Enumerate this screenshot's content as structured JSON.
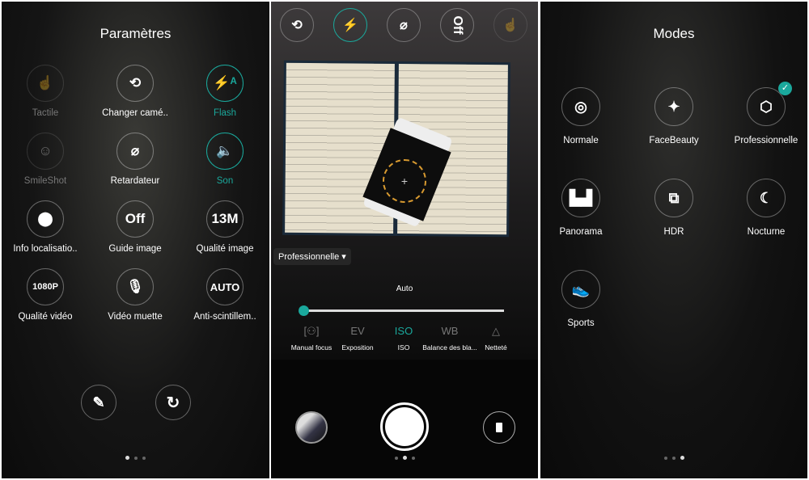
{
  "settings": {
    "title": "Paramètres",
    "items": [
      {
        "label": "Tactile",
        "icon": "touch-icon",
        "glyph": "☝",
        "state": "disabled"
      },
      {
        "label": "Changer camé..",
        "icon": "switch-camera-icon",
        "glyph": "⟲",
        "state": "normal"
      },
      {
        "label": "Flash",
        "icon": "flash-auto-icon",
        "glyph": "⚡ᴬ",
        "state": "active"
      },
      {
        "label": "SmileShot",
        "icon": "smile-icon",
        "glyph": "☺",
        "state": "disabled"
      },
      {
        "label": "Retardateur",
        "icon": "timer-off-icon",
        "glyph": "⌀",
        "state": "normal"
      },
      {
        "label": "Son",
        "icon": "sound-icon",
        "glyph": "🔈",
        "state": "active"
      },
      {
        "label": "Info localisatio..",
        "icon": "location-icon",
        "glyph": "⬤",
        "state": "normal"
      },
      {
        "label": "Guide image",
        "icon": "guide-off-icon",
        "glyph": "Off",
        "state": "normal"
      },
      {
        "label": "Qualité image",
        "icon": "resolution-icon",
        "glyph": "13M",
        "state": "normal"
      },
      {
        "label": "Qualité vidéo",
        "icon": "video-quality-icon",
        "glyph": "1080P",
        "state": "normal"
      },
      {
        "label": "Vidéo muette",
        "icon": "mic-off-icon",
        "glyph": "🎙",
        "state": "normal"
      },
      {
        "label": "Anti-scintillem..",
        "icon": "anti-flicker-icon",
        "glyph": "AUTO",
        "state": "normal"
      }
    ],
    "edit_icon": "✎",
    "reset_icon": "↻"
  },
  "camera": {
    "top_icons": [
      {
        "icon": "switch-camera-icon",
        "glyph": "⟲",
        "active": false
      },
      {
        "icon": "flash-auto-icon",
        "glyph": "⚡",
        "active": true
      },
      {
        "icon": "timer-off-icon",
        "glyph": "⌀",
        "active": false
      },
      {
        "icon": "guide-off-icon",
        "glyph": "Off",
        "active": false
      },
      {
        "icon": "touch-icon",
        "glyph": "☝",
        "active": false
      }
    ],
    "mode_dropdown": "Professionnelle ▾",
    "slider_value_label": "Auto",
    "slider_value": 0,
    "pro_tabs": [
      {
        "icon": "manual-focus-icon",
        "glyph": "[⚇]",
        "label": "Manual focus"
      },
      {
        "icon": "ev-icon",
        "glyph": "EV",
        "label": "Exposition"
      },
      {
        "icon": "iso-icon",
        "glyph": "ISO",
        "label": "ISO",
        "active": true
      },
      {
        "icon": "wb-icon",
        "glyph": "WB",
        "label": "Balance des bla..."
      },
      {
        "icon": "sharpness-icon",
        "glyph": "△",
        "label": "Netteté"
      }
    ]
  },
  "modes": {
    "title": "Modes",
    "items": [
      {
        "label": "Normale",
        "icon": "camera-icon",
        "glyph": "◎"
      },
      {
        "label": "FaceBeauty",
        "icon": "magic-wand-icon",
        "glyph": "✦"
      },
      {
        "label": "Professionnelle",
        "icon": "aperture-icon",
        "glyph": "⬡",
        "selected": true
      },
      {
        "label": "Panorama",
        "icon": "panorama-icon",
        "glyph": "▙▟"
      },
      {
        "label": "HDR",
        "icon": "hdr-icon",
        "glyph": "⧉"
      },
      {
        "label": "Nocturne",
        "icon": "moon-icon",
        "glyph": "☾"
      },
      {
        "label": "Sports",
        "icon": "shoe-icon",
        "glyph": "👟"
      }
    ]
  },
  "colors": {
    "accent": "#1aa89c"
  }
}
